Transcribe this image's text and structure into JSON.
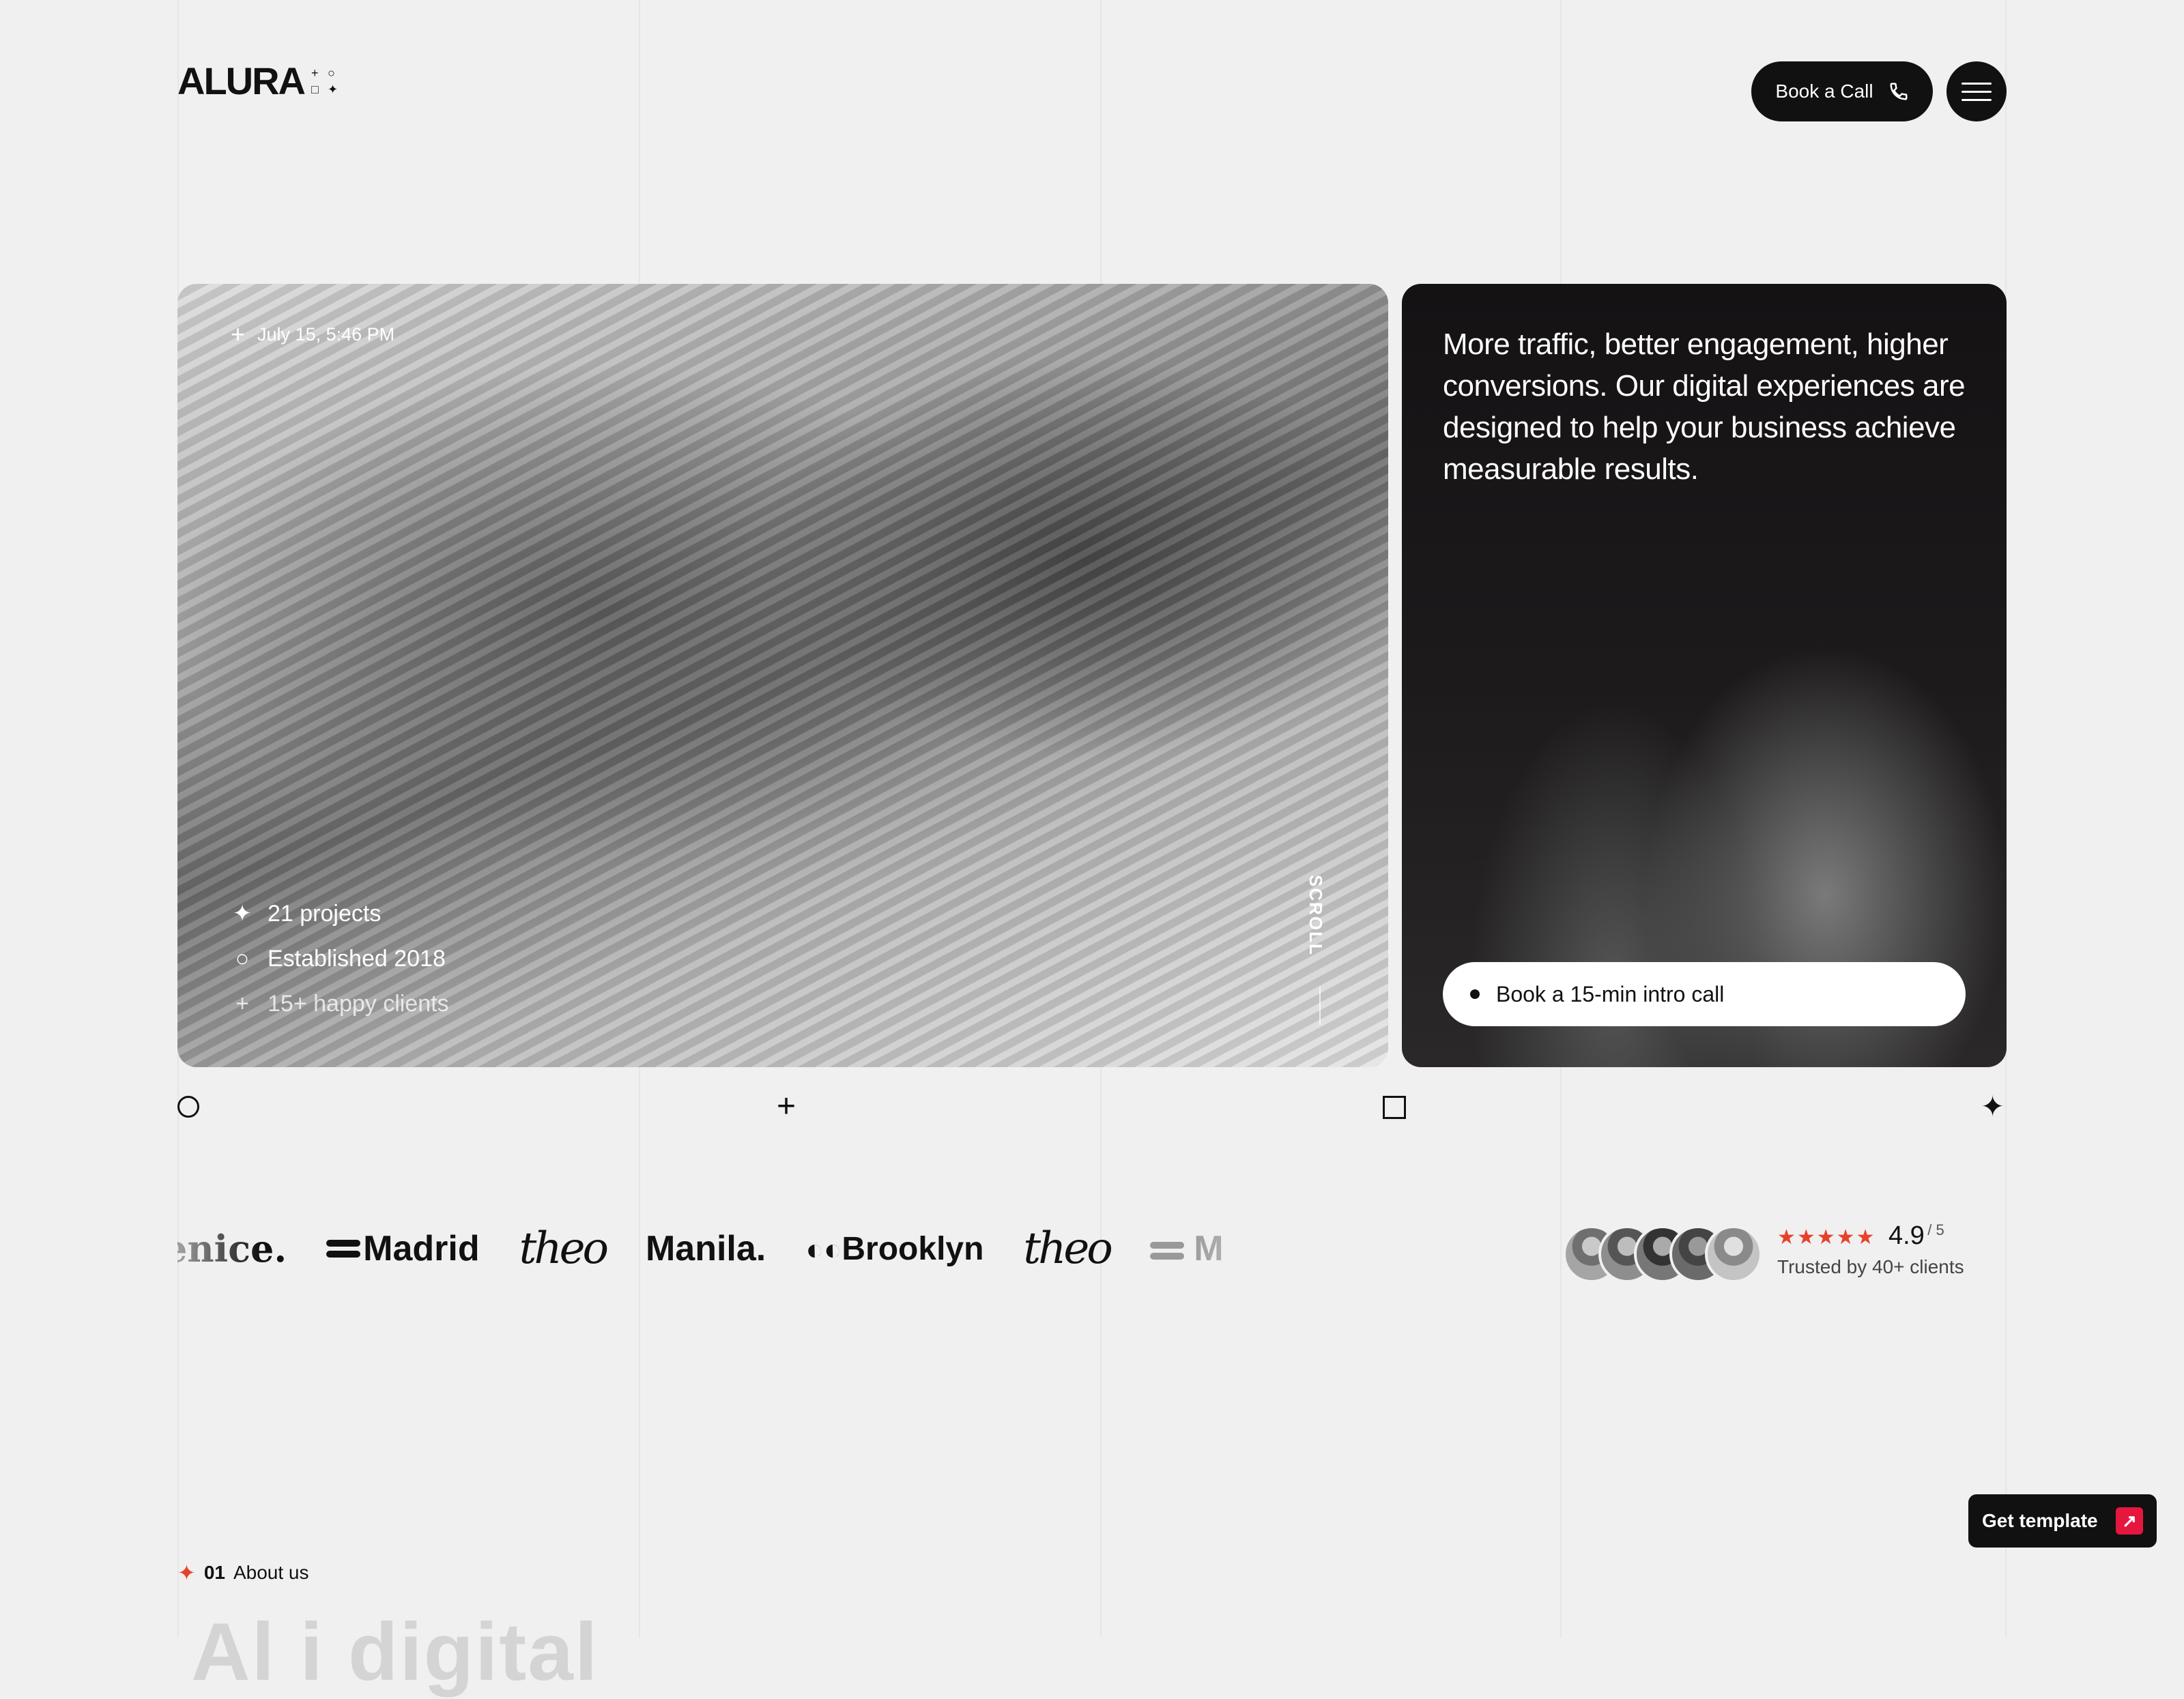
{
  "header": {
    "logo_text": "ALURA",
    "logo_marks": [
      "+",
      "○",
      "□",
      "✦"
    ],
    "book_call_label": "Book a Call"
  },
  "hero": {
    "date": "July 15, 5:46 PM",
    "stats": [
      {
        "icon": "sparkle-icon",
        "label": "21 projects"
      },
      {
        "icon": "circle-icon",
        "label": "Established 2018"
      },
      {
        "icon": "plus-icon",
        "label": "15+ happy clients"
      }
    ],
    "scroll_label": "SCROLL"
  },
  "dark_card": {
    "text": "More traffic, better engagement, higher conversions. Our digital experiences are designed to help your business achieve measurable results.",
    "intro_button": "Book a 15-min intro call"
  },
  "logos": [
    "enice.",
    "Madrid",
    "theo",
    "Manila.",
    "Brooklyn",
    "theo",
    "M"
  ],
  "rating": {
    "stars": "★★★★★",
    "score": "4.9",
    "max": "/ 5",
    "trusted": "Trusted by 40+ clients"
  },
  "get_template_label": "Get template",
  "section": {
    "number": "01",
    "label": "About us",
    "heading_peek": "Al    i       digital"
  },
  "colors": {
    "accent": "#e8412b",
    "cta": "#e5173f",
    "dark": "#111111",
    "background": "#f0f0f0"
  }
}
